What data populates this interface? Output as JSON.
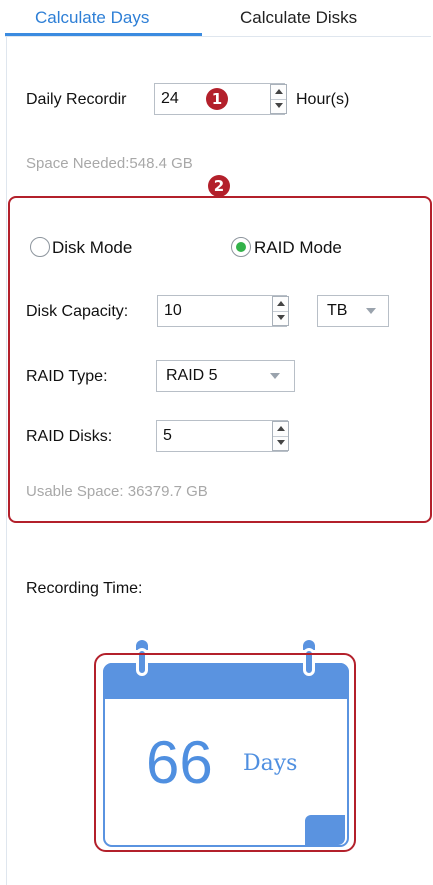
{
  "tabs": {
    "calculate_days": "Calculate Days",
    "calculate_disks": "Calculate Disks"
  },
  "daily_recording": {
    "label": "Daily Recordir",
    "value": "24",
    "unit": "Hour(s)"
  },
  "space_needed": "Space Needed:548.4 GB",
  "annotations": {
    "badge_1": "1",
    "badge_2": "2"
  },
  "mode": {
    "disk_mode_label": "Disk Mode",
    "raid_mode_label": "RAID Mode",
    "selected": "RAID Mode"
  },
  "disk_capacity": {
    "label": "Disk Capacity:",
    "value": "10",
    "unit_selected": "TB"
  },
  "raid_type": {
    "label": "RAID Type:",
    "selected": "RAID 5"
  },
  "raid_disks": {
    "label": "RAID Disks:",
    "value": "5"
  },
  "usable_space": "Usable Space: 36379.7 GB",
  "recording_time": {
    "label": "Recording Time:",
    "value": "66",
    "unit": "Days"
  },
  "colors": {
    "accent_blue": "#3b8be0",
    "calendar_blue": "#5a93e0",
    "annotation_red": "#b3202b",
    "radio_selected": "#33b24a"
  },
  "icons": {
    "calendar": "calendar-icon",
    "spinner_up": "triangle-up",
    "spinner_down": "triangle-down",
    "dropdown": "caret-down"
  }
}
